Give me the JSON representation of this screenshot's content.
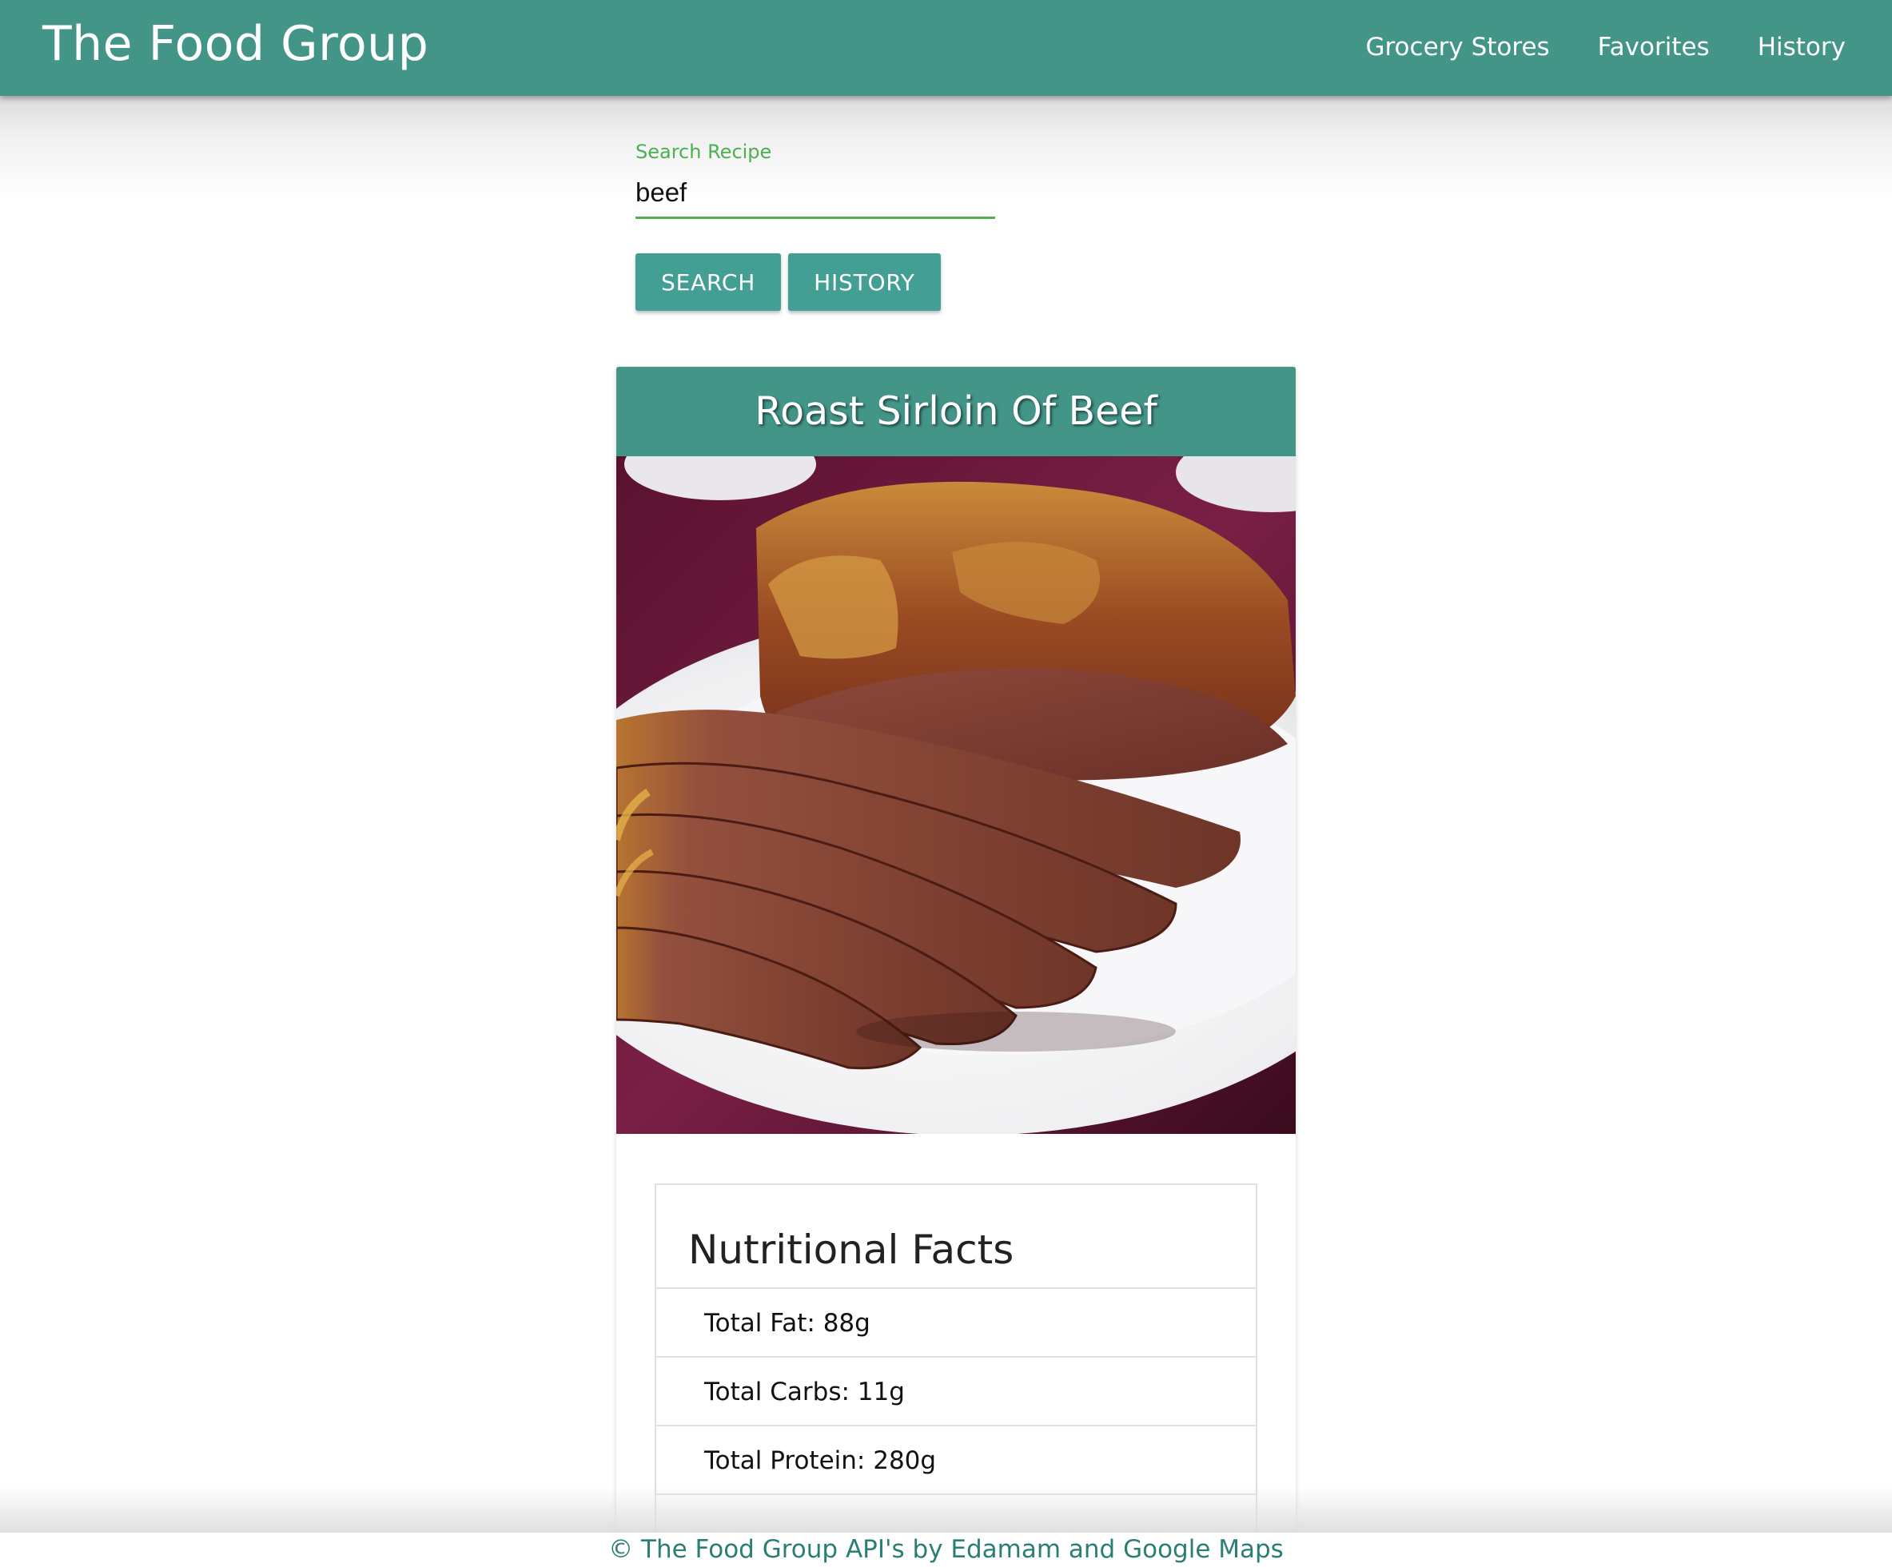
{
  "navbar": {
    "brand": "The Food Group",
    "links": [
      "Grocery Stores",
      "Favorites",
      "History"
    ]
  },
  "search": {
    "label": "Search Recipe",
    "value": "beef",
    "search_button": "SEARCH",
    "history_button": "HISTORY"
  },
  "recipe": {
    "title": "Roast Sirloin Of Beef",
    "image": "roast-sirloin-photo",
    "nutrition": {
      "heading": "Nutritional Facts",
      "items": [
        "Total Fat: 88g",
        "Total Carbs: 11g",
        "Total Protein: 280g"
      ]
    }
  },
  "footer": {
    "prefix": "© ",
    "brand_link": "The Food Group",
    "middle": " API's by ",
    "provider_link": "Edamam and Google Maps"
  },
  "colors": {
    "primary": "#439588",
    "button": "#439f93",
    "accent_green": "#4caf50",
    "footer_text": "#2a7f74"
  }
}
